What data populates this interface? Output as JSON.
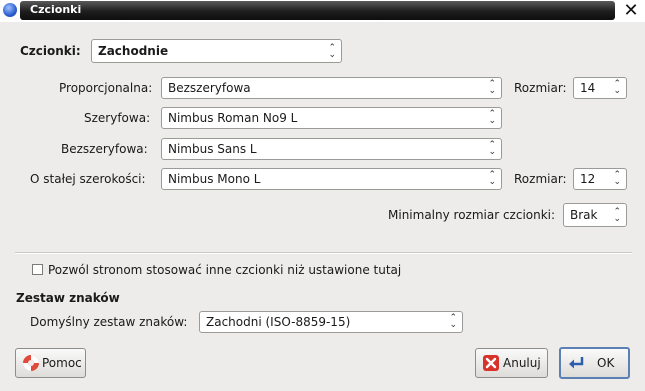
{
  "window": {
    "title": "Czcionki",
    "close_icon": "close-icon"
  },
  "fonts_for": {
    "label": "Czcionki:",
    "value": "Zachodnie"
  },
  "rows": {
    "proportional": {
      "label": "Proporcjonalna:",
      "value": "Bezszeryfowa",
      "size_label": "Rozmiar:",
      "size": "14"
    },
    "serif": {
      "label": "Szeryfowa:",
      "value": "Nimbus Roman No9 L"
    },
    "sans": {
      "label": "Bezszeryfowa:",
      "value": "Nimbus Sans L"
    },
    "mono": {
      "label": "O stałej szerokości:",
      "value": "Nimbus Mono L",
      "size_label": "Rozmiar:",
      "size": "12"
    }
  },
  "min_size": {
    "label": "Minimalny rozmiar czcionki:",
    "value": "Brak"
  },
  "allow_pages": {
    "label": "Pozwól stronom stosować inne czcionki niż ustawione tutaj",
    "checked": false
  },
  "charset": {
    "heading": "Zestaw znaków",
    "label": "Domyślny zestaw znaków:",
    "value": "Zachodni (ISO-8859-15)"
  },
  "buttons": {
    "help": "Pomoc",
    "cancel": "Anuluj",
    "ok": "OK"
  }
}
